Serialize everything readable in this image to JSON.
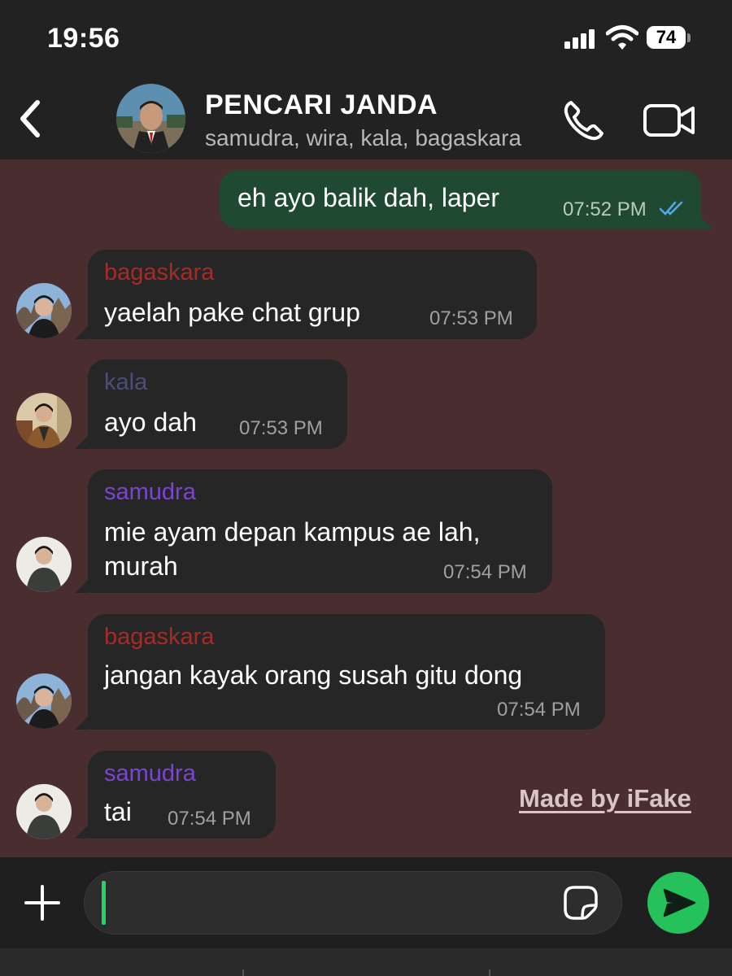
{
  "status_bar": {
    "time": "19:56",
    "battery": "74",
    "icons": [
      "cellular-signal-icon",
      "wifi-icon",
      "battery-icon"
    ]
  },
  "header": {
    "title": "PENCARI JANDA",
    "members": "samudra, wira, kala, bagaskara",
    "icons": [
      "back-chevron-icon",
      "phone-icon",
      "video-camera-icon"
    ]
  },
  "messages": [
    {
      "direction": "outgoing",
      "text": "eh ayo balik dah, laper",
      "time": "07:52 PM",
      "status": "read"
    },
    {
      "direction": "incoming",
      "sender": "bagaskara",
      "text": "yaelah pake chat grup",
      "time": "07:53 PM"
    },
    {
      "direction": "incoming",
      "sender": "kala",
      "text": "ayo dah",
      "time": "07:53 PM"
    },
    {
      "direction": "incoming",
      "sender": "samudra",
      "lines": [
        "mie ayam depan kampus ae lah,",
        "murah"
      ],
      "time": "07:54 PM"
    },
    {
      "direction": "incoming",
      "sender": "bagaskara",
      "text": "jangan kayak orang susah gitu dong",
      "time": "07:54 PM"
    },
    {
      "direction": "incoming",
      "sender": "samudra",
      "text": "tai",
      "time": "07:54 PM"
    }
  ],
  "sender_colors": {
    "bagaskara": "#a62b26",
    "kala": "#4d4d78",
    "samudra": "#7b45d0"
  },
  "theme": {
    "chat_background": "#4a2e2f",
    "incoming_bubble": "#262626",
    "outgoing_bubble": "#1f4a31",
    "read_tick": "#53a8e8",
    "send_button": "#25c15a"
  },
  "watermark": "Made by iFake",
  "composer": {
    "value": "",
    "icons": [
      "plus-icon",
      "sticker-icon",
      "send-arrow-icon"
    ]
  }
}
